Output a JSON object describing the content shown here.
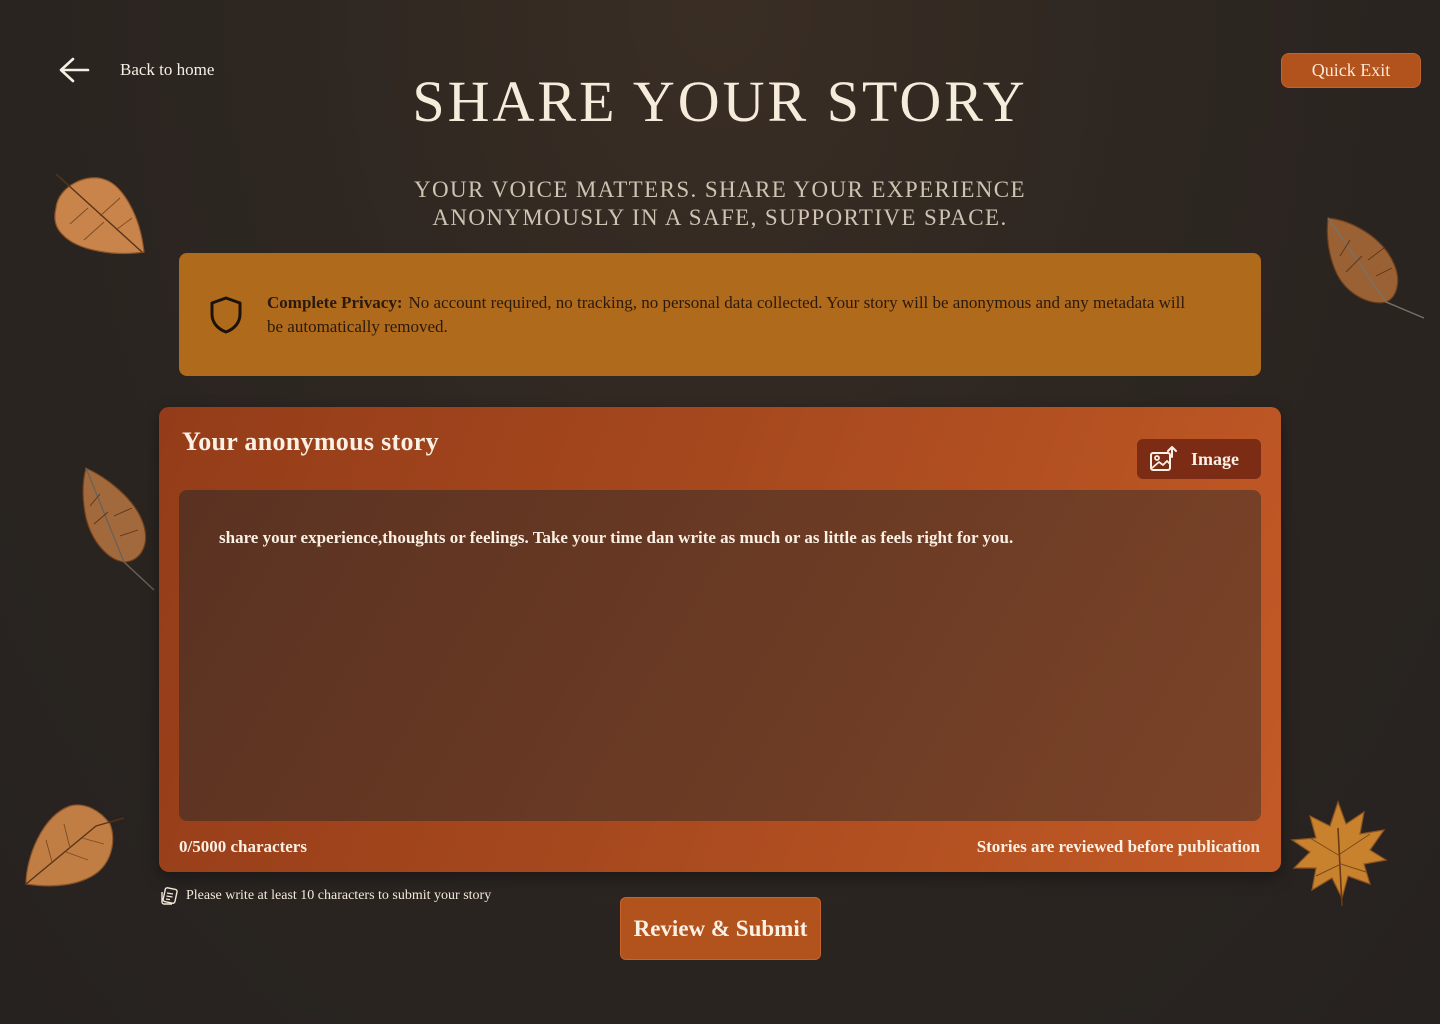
{
  "nav": {
    "back_label": "Back to home",
    "quick_exit_label": "Quick Exit"
  },
  "header": {
    "title": "SHARE YOUR STORY",
    "subtitle": "YOUR VOICE MATTERS. SHARE YOUR EXPERIENCE ANONYMOUSLY IN A SAFE, SUPPORTIVE SPACE."
  },
  "privacy": {
    "icon": "shield-icon",
    "label": "Complete Privacy:",
    "text": "No account required, no tracking, no personal data collected. Your story will be anonymous and any metadata will be automatically removed."
  },
  "story_form": {
    "title": "Your anonymous story",
    "image_button_label": "Image",
    "image_button_icon": "image-upload-icon",
    "placeholder": "share your experience,thoughts or feelings. Take your time dan write as much or as little as feels right for you.",
    "char_count": "0/5000 characters",
    "review_note": "Stories are reviewed before publication"
  },
  "hint": {
    "icon": "note-icon",
    "text": "Please write at least 10 characters to submit your story"
  },
  "submit_label": "Review & Submit",
  "colors": {
    "background": "#2d2621",
    "accent": "#b2521c",
    "privacy_banner": "#b06a1c",
    "card": "#a6481e",
    "textarea": "#6a3a24"
  }
}
